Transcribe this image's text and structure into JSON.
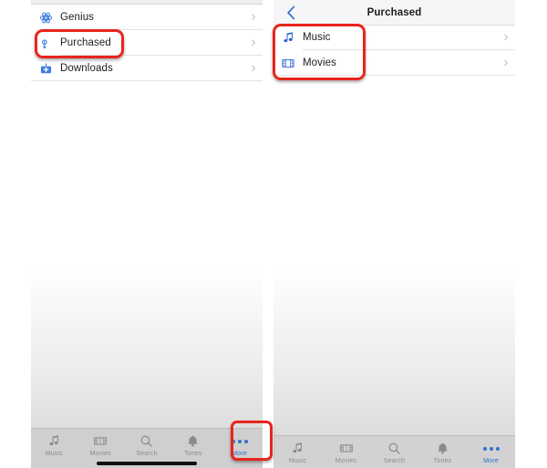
{
  "left_panel": {
    "name": "itunes-more-list",
    "rows": [
      {
        "label": "Genius",
        "icon": "genius-icon",
        "chevron": "›"
      },
      {
        "label": "Purchased",
        "icon": "purchased-icon",
        "chevron": "›"
      },
      {
        "label": "Downloads",
        "icon": "downloads-icon",
        "chevron": "›"
      }
    ],
    "tabbar": {
      "tabs": [
        {
          "label": "Music",
          "icon": "music-note-icon",
          "active": false
        },
        {
          "label": "Movies",
          "icon": "film-strip-icon",
          "active": false
        },
        {
          "label": "Search",
          "icon": "magnifier-icon",
          "active": false
        },
        {
          "label": "Tones",
          "icon": "bell-icon",
          "active": false
        },
        {
          "label": "More",
          "icon": "ellipsis-icon",
          "active": true
        }
      ]
    }
  },
  "right_panel": {
    "navbar": {
      "back_icon": "chevron-left-icon",
      "title": "Purchased"
    },
    "rows": [
      {
        "label": "Music",
        "icon": "music-note-icon",
        "chevron": "›"
      },
      {
        "label": "Movies",
        "icon": "film-strip-icon",
        "chevron": "›"
      }
    ],
    "tabbar": {
      "tabs": [
        {
          "label": "Music",
          "icon": "music-note-icon",
          "active": false
        },
        {
          "label": "Movies",
          "icon": "film-strip-icon",
          "active": false
        },
        {
          "label": "Search",
          "icon": "magnifier-icon",
          "active": false
        },
        {
          "label": "Tones",
          "icon": "bell-icon",
          "active": false
        },
        {
          "label": "More",
          "icon": "ellipsis-icon",
          "active": true
        }
      ]
    }
  },
  "annotations": {
    "color": "#e8251c",
    "boxes": [
      {
        "name": "highlight-purchased-row"
      },
      {
        "name": "highlight-more-tab"
      },
      {
        "name": "highlight-music-movies-rows"
      }
    ]
  },
  "colors": {
    "accent_blue": "#2f6fd0",
    "icon_blue": "#2b63d9",
    "text_primary": "#1c1c1e",
    "tab_inactive": "#8a8a8e",
    "annotation_red": "#e8251c"
  }
}
